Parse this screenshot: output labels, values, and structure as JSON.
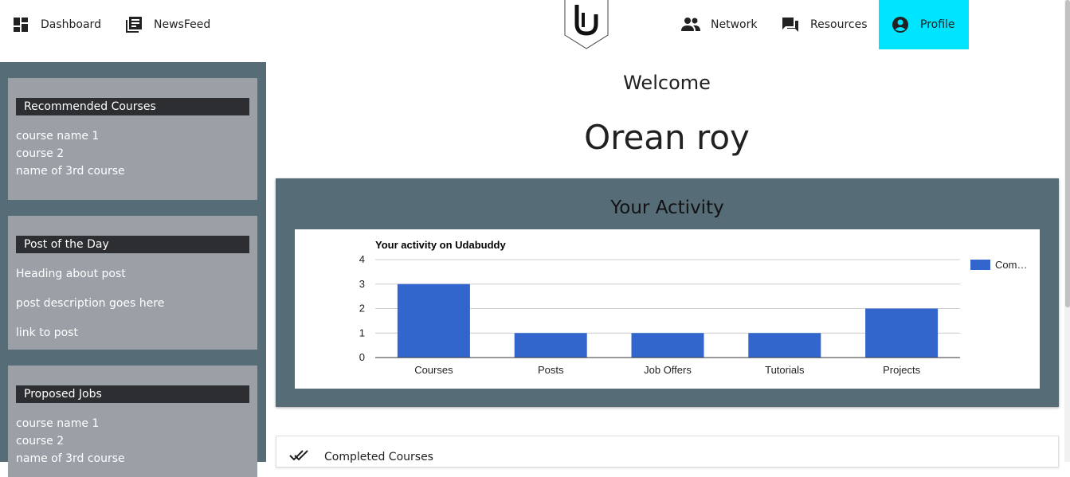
{
  "nav": {
    "left": [
      {
        "label": "Dashboard",
        "icon": "dashboard-icon"
      },
      {
        "label": "NewsFeed",
        "icon": "newsfeed-icon"
      }
    ],
    "right": [
      {
        "label": "Network",
        "icon": "people-icon"
      },
      {
        "label": "Resources",
        "icon": "forum-icon"
      },
      {
        "label": "Profile",
        "icon": "account-circle-icon",
        "active": true
      }
    ],
    "active_color": "#00e5ff"
  },
  "logo": {
    "icon": "udabuddy-logo"
  },
  "sidebar": {
    "background": "#566d78",
    "card_color": "#9aa0a6",
    "recommended": {
      "title": "Recommended Courses",
      "items": [
        "course name 1",
        "course 2",
        "name of 3rd course"
      ]
    },
    "post_of_day": {
      "title": "Post of the Day",
      "heading": "Heading about post",
      "description": "post description goes here",
      "link": "link to post"
    },
    "jobs": {
      "title": "Proposed Jobs",
      "items": [
        "course name 1",
        "course 2",
        "name of 3rd course"
      ]
    }
  },
  "main": {
    "welcome": "Welcome",
    "username": "Orean roy",
    "activity_title": "Your Activity",
    "completed_label": "Completed Courses",
    "completed_icon": "done-all-icon"
  },
  "chart_data": {
    "type": "bar",
    "title": "Your activity on Udabuddy",
    "categories": [
      "Courses",
      "Posts",
      "Job Offers",
      "Tutorials",
      "Projects"
    ],
    "series": [
      {
        "name": "Com…",
        "values": [
          3,
          1,
          1,
          1,
          2
        ],
        "color": "#3366cc"
      }
    ],
    "ylim": [
      0,
      4
    ],
    "yticks": [
      0,
      1,
      2,
      3,
      4
    ],
    "grid": true,
    "legend": "right"
  }
}
